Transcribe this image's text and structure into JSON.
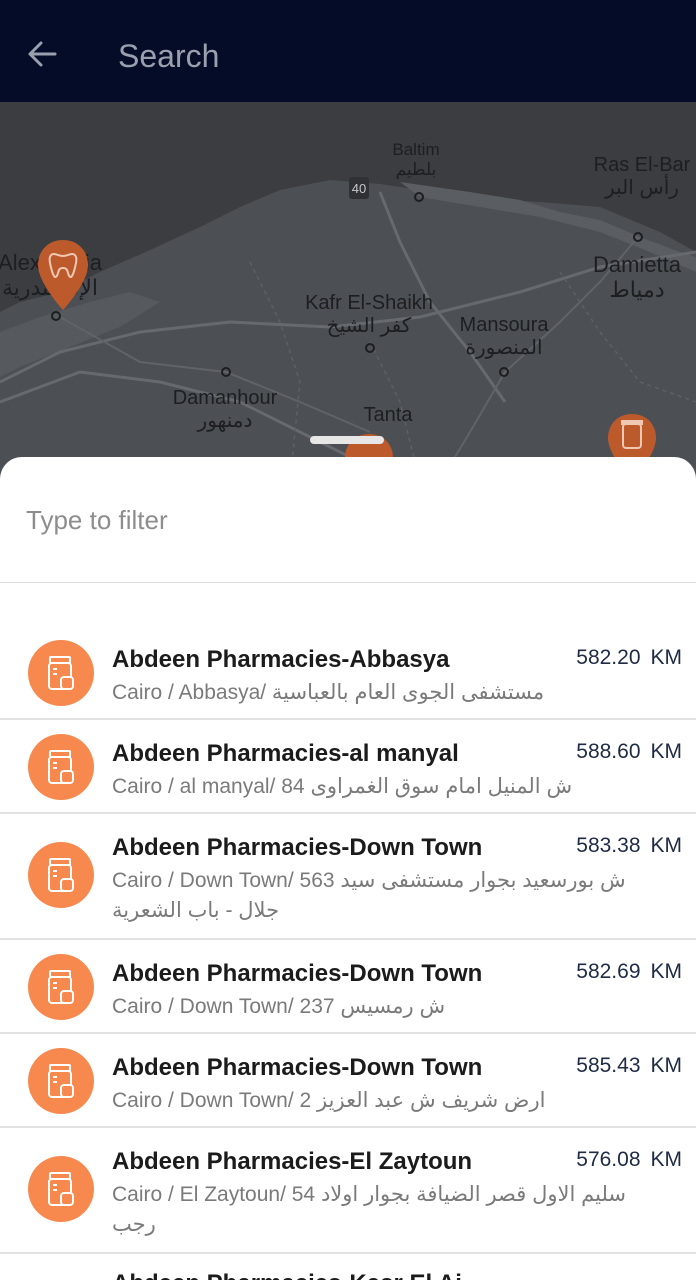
{
  "header": {
    "title": "Search",
    "back_icon": "arrow-left-icon"
  },
  "map": {
    "labels": {
      "baltim_en": "Baltim",
      "baltim_ar": "بلطيم",
      "ras_en": "Ras El-Bar",
      "ras_ar": "رأس البر",
      "alex_en": "Alexandria",
      "alex_ar": "الإسكندرية",
      "damietta_en": "Damietta",
      "damietta_ar": "دمياط",
      "kafr_en": "Kafr El-Shaikh",
      "kafr_ar": "كفر الشيخ",
      "mansoura_en": "Mansoura",
      "mansoura_ar": "المنصورة",
      "damanhour_en": "Damanhour",
      "damanhour_ar": "دمنهور",
      "tanta_en": "Tanta",
      "road_number": "40"
    },
    "markers": [
      "tooth-marker-icon",
      "pharmacy-marker-icon",
      "pharmacy-marker-icon"
    ]
  },
  "filter": {
    "placeholder": "Type to filter",
    "value": ""
  },
  "results": [
    {
      "name": "Abdeen Pharmacies-Abbasya",
      "address": "Cairo / Abbasya/ مستشفى الجوى العام بالعباسية",
      "distance": "582.20",
      "unit": "KM"
    },
    {
      "name": "Abdeen Pharmacies-al manyal",
      "address": "Cairo / al manyal/ 84 ش المنيل امام سوق الغمراوى",
      "distance": "588.60",
      "unit": "KM"
    },
    {
      "name": "Abdeen Pharmacies-Down Town",
      "address": "Cairo / Down Town/ 563 ش بورسعيد بجوار مستشفى سيد جلال - باب الشعرية",
      "distance": "583.38",
      "unit": "KM"
    },
    {
      "name": "Abdeen Pharmacies-Down Town",
      "address": "Cairo / Down Town/ 237 ش رمسيس",
      "distance": "582.69",
      "unit": "KM"
    },
    {
      "name": "Abdeen Pharmacies-Down Town",
      "address": "Cairo / Down Town/ 2 ارض شريف ش عبد العزيز",
      "distance": "585.43",
      "unit": "KM"
    },
    {
      "name": "Abdeen Pharmacies-El Zaytoun",
      "address": "Cairo / El Zaytoun/ 54 سليم الاول قصر الضيافة بجوار اولاد رجب",
      "distance": "576.08",
      "unit": "KM"
    },
    {
      "name": "Abdeen Pharmacies-Kasr El Ai",
      "address": "",
      "distance": "",
      "unit": ""
    }
  ],
  "colors": {
    "appbar": "#040c28",
    "accent": "#f7894e",
    "distance_text": "#1f2a44"
  }
}
